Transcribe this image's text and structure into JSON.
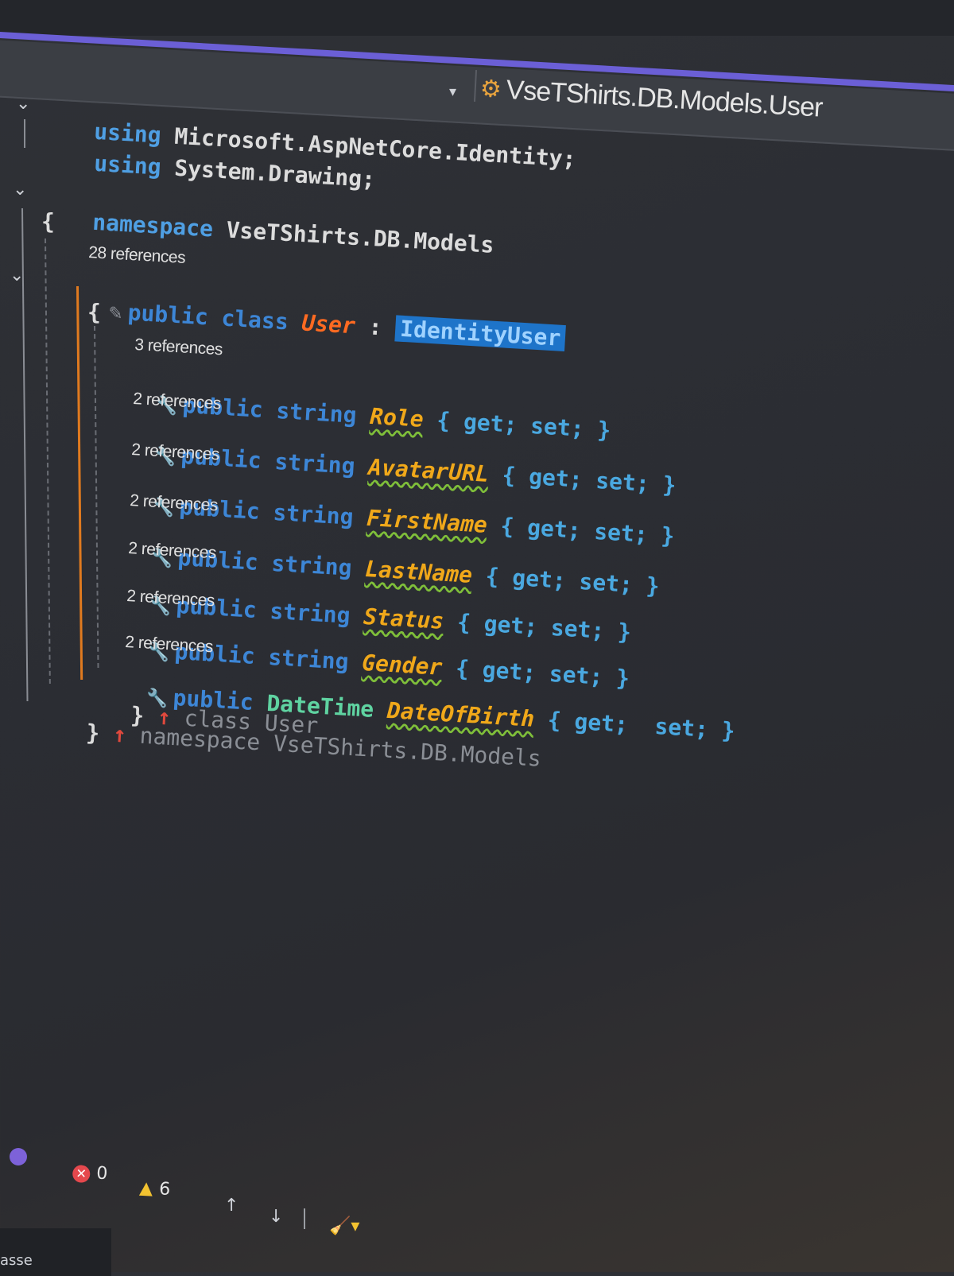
{
  "navigation_bar": {
    "member_path": "VseTShirts.DB.Models.User",
    "dropdown_glyph": "▾",
    "member_icon": "class-member-icon"
  },
  "code": {
    "using_1": {
      "keyword": "using",
      "text": "Microsoft.AspNetCore.Identity;"
    },
    "using_2": {
      "keyword": "using",
      "text": "System.Drawing;"
    },
    "namespace": {
      "keyword": "namespace",
      "name": "VseTShirts.DB.Models"
    },
    "open_brace_ns": "{",
    "class_refs": "28 references",
    "class_decl": {
      "modifiers": "public class",
      "name": "User",
      "colon": ":",
      "base": "IdentityUser"
    },
    "open_brace_cls": "{",
    "properties": [
      {
        "refs": "3 references",
        "modifiers": "public",
        "type": "string",
        "name": "Role",
        "accessors": "{ get; set; }"
      },
      {
        "refs": "2 references",
        "modifiers": "public",
        "type": "string",
        "name": "AvatarURL",
        "accessors": "{ get; set; }"
      },
      {
        "refs": "2 references",
        "modifiers": "public",
        "type": "string",
        "name": "FirstName",
        "accessors": "{ get; set; }"
      },
      {
        "refs": "2 references",
        "modifiers": "public",
        "type": "string",
        "name": "LastName",
        "accessors": "{ get; set; }"
      },
      {
        "refs": "2 references",
        "modifiers": "public",
        "type": "string",
        "name": "Status",
        "accessors": "{ get; set; }"
      },
      {
        "refs": "2 references",
        "modifiers": "public",
        "type": "string",
        "name": "Gender",
        "accessors": "{ get; set; }"
      },
      {
        "refs": "2 references",
        "modifiers": "public",
        "type": "DateTime",
        "name": "DateOfBirth",
        "accessors": "{ get;  set; }"
      }
    ],
    "close_cls": {
      "brace": "}",
      "hint": "class User"
    },
    "close_ns": {
      "brace": "}",
      "hint": "namespace VseTShirts.DB.Models"
    }
  },
  "status_bar": {
    "errors": "0",
    "warnings": "6",
    "up_glyph": "↑",
    "down_glyph": "↓",
    "bottom_text": "asse"
  }
}
